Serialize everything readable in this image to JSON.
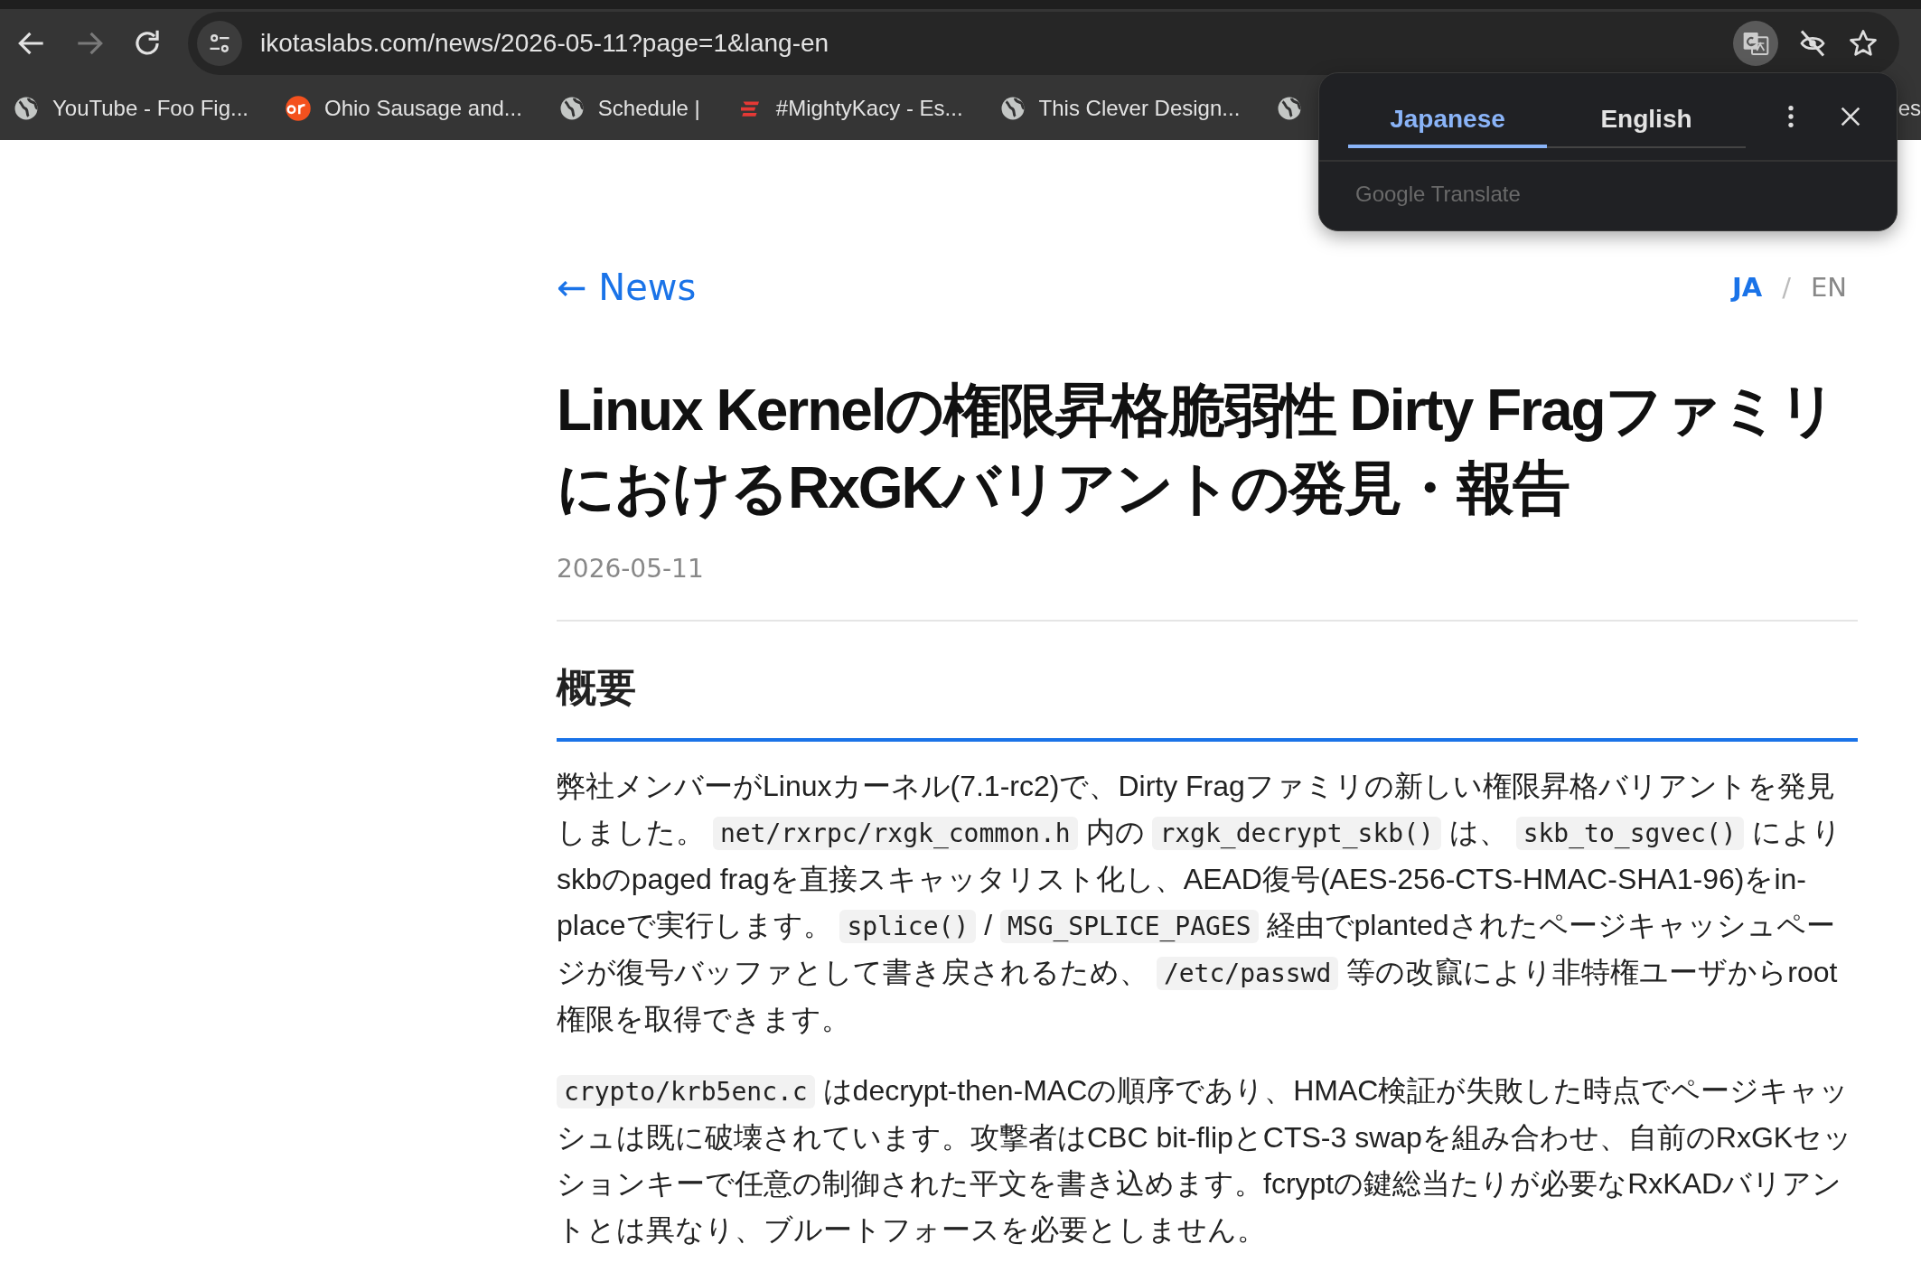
{
  "toolbar": {
    "back": {
      "disabled": false
    },
    "forward": {
      "disabled": true
    },
    "url": "ikotaslabs.com/news/2026-05-11?page=1&lang-en",
    "translate_active": true
  },
  "bookmarks": [
    {
      "label": "YouTube - Foo Fig...",
      "kind": "globe"
    },
    {
      "label": "Ohio Sausage and...",
      "kind": "ar"
    },
    {
      "label": "Schedule |",
      "kind": "globe"
    },
    {
      "label": "#MightyKacy - Es...",
      "kind": "espn"
    },
    {
      "label": "This Clever Design...",
      "kind": "globe"
    },
    {
      "kind": "globe"
    },
    {
      "label": "es",
      "kind": "cut"
    }
  ],
  "translate_popup": {
    "tabs": [
      {
        "label": "Japanese",
        "selected": true
      },
      {
        "label": "English",
        "selected": false
      }
    ],
    "footer": "Google Translate"
  },
  "article": {
    "back_link": "← News",
    "languages": [
      {
        "label": "JA",
        "selected": true
      },
      {
        "label": "EN",
        "selected": false
      }
    ],
    "separator": "/",
    "title": "Linux Kernelの権限昇格脆弱性 Dirty FragファミリにおけるRxGKバリアントの発見・報告",
    "date": "2026-05-11",
    "heading": "概要",
    "paragraphs": [
      [
        {
          "kind": "text",
          "text": "弊社メンバーがLinuxカーネル(7.1-rc2)で、Dirty Fragファミリの新しい権限昇格バリアントを発見しました。 "
        },
        {
          "kind": "code",
          "text": "net/rxrpc/rxgk_common.h"
        },
        {
          "kind": "text",
          "text": " 内の "
        },
        {
          "kind": "code",
          "text": "rxgk_decrypt_skb()"
        },
        {
          "kind": "text",
          "text": " は、 "
        },
        {
          "kind": "code",
          "text": "skb_to_sgvec()"
        },
        {
          "kind": "text",
          "text": " によりskbのpaged fragを直接スキャッタリスト化し、AEAD復号(AES-256-CTS-HMAC-SHA1-96)をin-placeで実行します。 "
        },
        {
          "kind": "code",
          "text": "splice()"
        },
        {
          "kind": "text",
          "text": " / "
        },
        {
          "kind": "code",
          "text": "MSG_SPLICE_PAGES"
        },
        {
          "kind": "text",
          "text": " 経由でplantedされたページキャッシュページが復号バッファとして書き戻されるため、 "
        },
        {
          "kind": "code",
          "text": "/etc/passwd"
        },
        {
          "kind": "text",
          "text": " 等の改竄により非特権ユーザからroot権限を取得できます。"
        }
      ],
      [
        {
          "kind": "code",
          "text": "crypto/krb5enc.c"
        },
        {
          "kind": "text",
          "text": " はdecrypt-then-MACの順序であり、HMAC検証が失敗した時点でページキャッシュは既に破壊されています。攻撃者はCBC bit-flipとCTS-3 swapを組み合わせ、自前のRxGKセッションキーで任意の制御された平文を書き込めます。fcryptの鍵総当たりが必要なRxKADバリアントとは異なり、ブルートフォースを必要としません。"
        }
      ]
    ]
  }
}
